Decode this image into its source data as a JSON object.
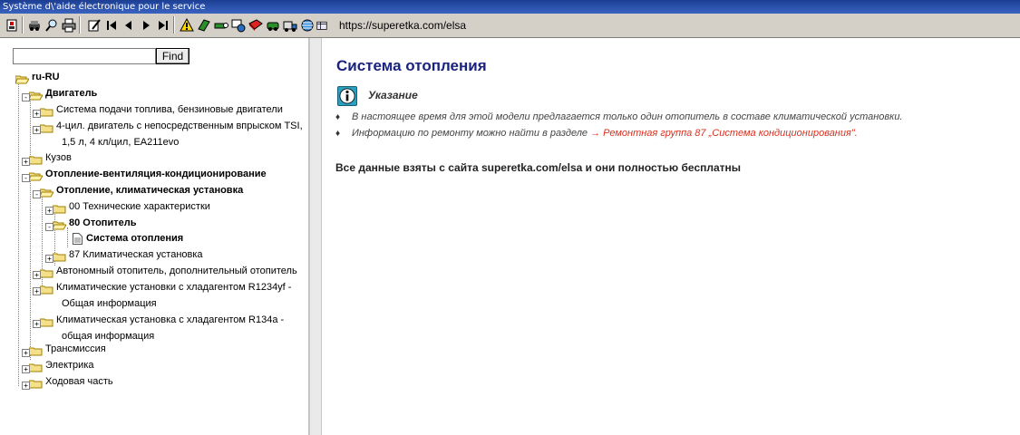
{
  "window": {
    "title": "Système d\\'aide électronique pour le service"
  },
  "toolbar": {
    "url": "https://superetka.com/elsa",
    "buttons": [
      {
        "name": "user-icon"
      },
      {
        "name": "car-icon"
      },
      {
        "name": "search-icon"
      },
      {
        "name": "print-icon"
      },
      {
        "name": "edit-icon"
      },
      {
        "name": "first-page-icon"
      },
      {
        "name": "prev-page-icon"
      },
      {
        "name": "next-page-icon"
      },
      {
        "name": "last-page-icon"
      },
      {
        "name": "warning-icon"
      },
      {
        "name": "book-icon"
      },
      {
        "name": "tool-icon"
      },
      {
        "name": "diagram-icon"
      },
      {
        "name": "manual-icon"
      },
      {
        "name": "vehicle-icon"
      },
      {
        "name": "truck-icon"
      },
      {
        "name": "globe-icon"
      },
      {
        "name": "table-icon"
      }
    ]
  },
  "search": {
    "value": "",
    "button_label": "Find"
  },
  "tree": {
    "root": "ru-RU",
    "n1": "Двигатель",
    "n2": "Система подачи топлива, бензиновые двигатели",
    "n3a": "4-цил. двигатель с непосредственным впрыском TSI,",
    "n3b": "1,5 л, 4 кл/цил, EA211evo",
    "n4": "Кузов",
    "n5": "Отопление-вентиляция-кондиционирование",
    "n6": "Отопление, климатическая установка",
    "n7": "00 Технические характеристки",
    "n8": "80 Отопитель",
    "n9": "Система отопления",
    "n10": "87 Климатическая установка",
    "n11": "Автономный отопитель, дополнительный отопитель",
    "n12a": "Климатические установки с хладагентом R1234yf -",
    "n12b": "Общая информация",
    "n13a": "Климатическая установка с хладагентом R134a -",
    "n13b": "общая информация",
    "n14": "Трансмиссия",
    "n15": "Электрика",
    "n16": "Ходовая часть"
  },
  "content": {
    "title": "Система отопления",
    "note_title": "Указание",
    "bullet_1": "В настоящее время для этой модели предлагается только один отопитель в составе климатической установки.",
    "bullet_2_text": "Информацию по ремонту можно найти в разделе",
    "bullet_2_link": "→ Ремонтная группа 87 „Система кондиционирования\".",
    "footer": "Все данные взяты с сайта superetka.com/elsa и они полностью бесплатны"
  },
  "colors": {
    "title": "#1a237e",
    "link": "#d9301e",
    "note_icon": "#2aa0c0",
    "titlebar": "#1c3f94"
  }
}
